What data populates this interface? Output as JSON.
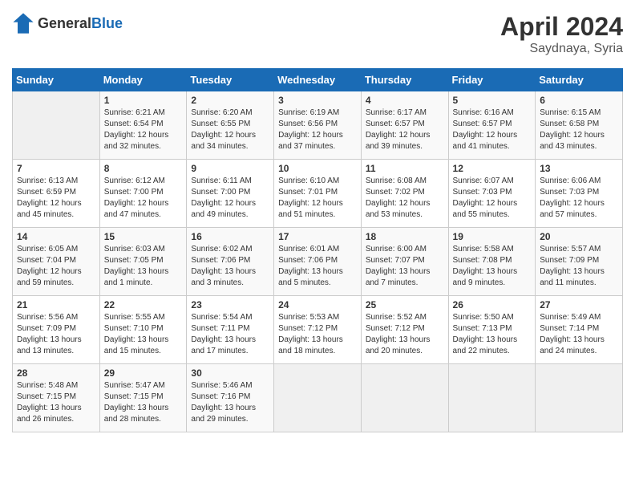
{
  "header": {
    "logo_general": "General",
    "logo_blue": "Blue",
    "month": "April 2024",
    "location": "Saydnaya, Syria"
  },
  "days_of_week": [
    "Sunday",
    "Monday",
    "Tuesday",
    "Wednesday",
    "Thursday",
    "Friday",
    "Saturday"
  ],
  "weeks": [
    [
      {
        "day": "",
        "sunrise": "",
        "sunset": "",
        "daylight": "",
        "empty": true
      },
      {
        "day": "1",
        "sunrise": "Sunrise: 6:21 AM",
        "sunset": "Sunset: 6:54 PM",
        "daylight": "Daylight: 12 hours and 32 minutes."
      },
      {
        "day": "2",
        "sunrise": "Sunrise: 6:20 AM",
        "sunset": "Sunset: 6:55 PM",
        "daylight": "Daylight: 12 hours and 34 minutes."
      },
      {
        "day": "3",
        "sunrise": "Sunrise: 6:19 AM",
        "sunset": "Sunset: 6:56 PM",
        "daylight": "Daylight: 12 hours and 37 minutes."
      },
      {
        "day": "4",
        "sunrise": "Sunrise: 6:17 AM",
        "sunset": "Sunset: 6:57 PM",
        "daylight": "Daylight: 12 hours and 39 minutes."
      },
      {
        "day": "5",
        "sunrise": "Sunrise: 6:16 AM",
        "sunset": "Sunset: 6:57 PM",
        "daylight": "Daylight: 12 hours and 41 minutes."
      },
      {
        "day": "6",
        "sunrise": "Sunrise: 6:15 AM",
        "sunset": "Sunset: 6:58 PM",
        "daylight": "Daylight: 12 hours and 43 minutes."
      }
    ],
    [
      {
        "day": "7",
        "sunrise": "Sunrise: 6:13 AM",
        "sunset": "Sunset: 6:59 PM",
        "daylight": "Daylight: 12 hours and 45 minutes."
      },
      {
        "day": "8",
        "sunrise": "Sunrise: 6:12 AM",
        "sunset": "Sunset: 7:00 PM",
        "daylight": "Daylight: 12 hours and 47 minutes."
      },
      {
        "day": "9",
        "sunrise": "Sunrise: 6:11 AM",
        "sunset": "Sunset: 7:00 PM",
        "daylight": "Daylight: 12 hours and 49 minutes."
      },
      {
        "day": "10",
        "sunrise": "Sunrise: 6:10 AM",
        "sunset": "Sunset: 7:01 PM",
        "daylight": "Daylight: 12 hours and 51 minutes."
      },
      {
        "day": "11",
        "sunrise": "Sunrise: 6:08 AM",
        "sunset": "Sunset: 7:02 PM",
        "daylight": "Daylight: 12 hours and 53 minutes."
      },
      {
        "day": "12",
        "sunrise": "Sunrise: 6:07 AM",
        "sunset": "Sunset: 7:03 PM",
        "daylight": "Daylight: 12 hours and 55 minutes."
      },
      {
        "day": "13",
        "sunrise": "Sunrise: 6:06 AM",
        "sunset": "Sunset: 7:03 PM",
        "daylight": "Daylight: 12 hours and 57 minutes."
      }
    ],
    [
      {
        "day": "14",
        "sunrise": "Sunrise: 6:05 AM",
        "sunset": "Sunset: 7:04 PM",
        "daylight": "Daylight: 12 hours and 59 minutes."
      },
      {
        "day": "15",
        "sunrise": "Sunrise: 6:03 AM",
        "sunset": "Sunset: 7:05 PM",
        "daylight": "Daylight: 13 hours and 1 minute."
      },
      {
        "day": "16",
        "sunrise": "Sunrise: 6:02 AM",
        "sunset": "Sunset: 7:06 PM",
        "daylight": "Daylight: 13 hours and 3 minutes."
      },
      {
        "day": "17",
        "sunrise": "Sunrise: 6:01 AM",
        "sunset": "Sunset: 7:06 PM",
        "daylight": "Daylight: 13 hours and 5 minutes."
      },
      {
        "day": "18",
        "sunrise": "Sunrise: 6:00 AM",
        "sunset": "Sunset: 7:07 PM",
        "daylight": "Daylight: 13 hours and 7 minutes."
      },
      {
        "day": "19",
        "sunrise": "Sunrise: 5:58 AM",
        "sunset": "Sunset: 7:08 PM",
        "daylight": "Daylight: 13 hours and 9 minutes."
      },
      {
        "day": "20",
        "sunrise": "Sunrise: 5:57 AM",
        "sunset": "Sunset: 7:09 PM",
        "daylight": "Daylight: 13 hours and 11 minutes."
      }
    ],
    [
      {
        "day": "21",
        "sunrise": "Sunrise: 5:56 AM",
        "sunset": "Sunset: 7:09 PM",
        "daylight": "Daylight: 13 hours and 13 minutes."
      },
      {
        "day": "22",
        "sunrise": "Sunrise: 5:55 AM",
        "sunset": "Sunset: 7:10 PM",
        "daylight": "Daylight: 13 hours and 15 minutes."
      },
      {
        "day": "23",
        "sunrise": "Sunrise: 5:54 AM",
        "sunset": "Sunset: 7:11 PM",
        "daylight": "Daylight: 13 hours and 17 minutes."
      },
      {
        "day": "24",
        "sunrise": "Sunrise: 5:53 AM",
        "sunset": "Sunset: 7:12 PM",
        "daylight": "Daylight: 13 hours and 18 minutes."
      },
      {
        "day": "25",
        "sunrise": "Sunrise: 5:52 AM",
        "sunset": "Sunset: 7:12 PM",
        "daylight": "Daylight: 13 hours and 20 minutes."
      },
      {
        "day": "26",
        "sunrise": "Sunrise: 5:50 AM",
        "sunset": "Sunset: 7:13 PM",
        "daylight": "Daylight: 13 hours and 22 minutes."
      },
      {
        "day": "27",
        "sunrise": "Sunrise: 5:49 AM",
        "sunset": "Sunset: 7:14 PM",
        "daylight": "Daylight: 13 hours and 24 minutes."
      }
    ],
    [
      {
        "day": "28",
        "sunrise": "Sunrise: 5:48 AM",
        "sunset": "Sunset: 7:15 PM",
        "daylight": "Daylight: 13 hours and 26 minutes."
      },
      {
        "day": "29",
        "sunrise": "Sunrise: 5:47 AM",
        "sunset": "Sunset: 7:15 PM",
        "daylight": "Daylight: 13 hours and 28 minutes."
      },
      {
        "day": "30",
        "sunrise": "Sunrise: 5:46 AM",
        "sunset": "Sunset: 7:16 PM",
        "daylight": "Daylight: 13 hours and 29 minutes."
      },
      {
        "day": "",
        "sunrise": "",
        "sunset": "",
        "daylight": "",
        "empty": true
      },
      {
        "day": "",
        "sunrise": "",
        "sunset": "",
        "daylight": "",
        "empty": true
      },
      {
        "day": "",
        "sunrise": "",
        "sunset": "",
        "daylight": "",
        "empty": true
      },
      {
        "day": "",
        "sunrise": "",
        "sunset": "",
        "daylight": "",
        "empty": true
      }
    ]
  ]
}
